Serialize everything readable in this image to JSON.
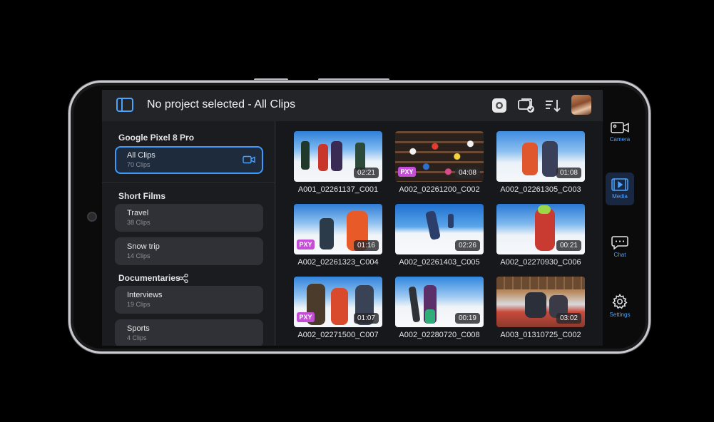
{
  "header": {
    "title": "No project selected - All Clips"
  },
  "sidebar": {
    "device_title": "Google Pixel 8 Pro",
    "all_clips": {
      "name": "All Clips",
      "count": "70 Clips"
    },
    "short_films_title": "Short Films",
    "short_films": [
      {
        "name": "Travel",
        "count": "38 Clips"
      },
      {
        "name": "Snow trip",
        "count": "14 Clips"
      }
    ],
    "documentaries_title": "Documentaries",
    "documentaries": [
      {
        "name": "Interviews",
        "count": "19 Clips"
      },
      {
        "name": "Sports",
        "count": "4 Clips"
      }
    ]
  },
  "clips": [
    {
      "name": "A001_02261137_C001",
      "duration": "02:21",
      "proxy": ""
    },
    {
      "name": "A002_02261200_C002",
      "duration": "04:08",
      "proxy": "PXY"
    },
    {
      "name": "A002_02261305_C003",
      "duration": "01:08",
      "proxy": ""
    },
    {
      "name": "A002_02261323_C004",
      "duration": "01:16",
      "proxy": "PXY"
    },
    {
      "name": "A002_02261403_C005",
      "duration": "02:26",
      "proxy": ""
    },
    {
      "name": "A002_02270930_C006",
      "duration": "00:21",
      "proxy": ""
    },
    {
      "name": "A002_02271500_C007",
      "duration": "01:07",
      "proxy": "PXY"
    },
    {
      "name": "A002_02280720_C008",
      "duration": "00:19",
      "proxy": ""
    },
    {
      "name": "A003_01310725_C002",
      "duration": "03:02",
      "proxy": ""
    }
  ],
  "rail": {
    "camera": "Camera",
    "media": "Media",
    "chat": "Chat",
    "settings": "Settings"
  },
  "colors": {
    "accent": "#3d9bff",
    "proxy_badge": "#c44fd6",
    "background": "#1d1e22"
  },
  "icons": {
    "sidebar_toggle": "sidebar-toggle-icon",
    "flag": "flag-icon",
    "clips_check": "clips-check-icon",
    "sort": "sort-icon",
    "share": "share-icon",
    "camera": "camera-icon",
    "media": "film-icon",
    "chat": "chat-icon",
    "settings": "gear-icon"
  }
}
